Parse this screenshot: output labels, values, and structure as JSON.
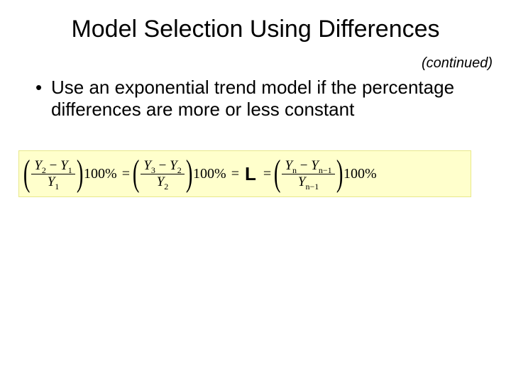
{
  "title": "Model Selection Using Differences",
  "continued": "(continued)",
  "bullet": "Use an exponential trend model if the percentage differences are more or less constant",
  "formula": {
    "term1_num": "Y₂ − Y₁",
    "term1_den": "Y₁",
    "pct": "100%",
    "eq": "=",
    "term2_num": "Y₃ − Y₂",
    "term2_den": "Y₂",
    "ellipsis": "L",
    "termN_num": "Yₙ − Yₙ₋₁",
    "termN_den": "Yₙ₋₁"
  }
}
